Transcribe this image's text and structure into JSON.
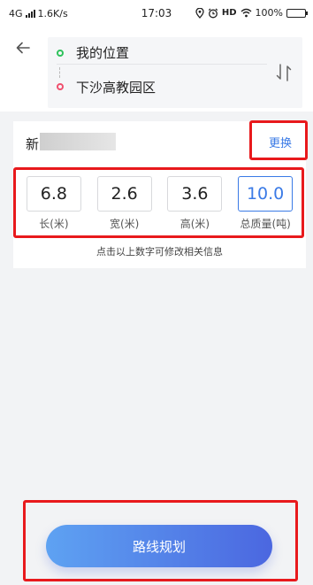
{
  "status_bar": {
    "network": "4G",
    "speed": "1.6K/s",
    "time": "17:03",
    "hd": "HD",
    "battery": "100%"
  },
  "route": {
    "start": "我的位置",
    "end": "下沙高教园区"
  },
  "vehicle": {
    "plate_prefix": "新",
    "change_label": "更换"
  },
  "dimensions": [
    {
      "value": "6.8",
      "label": "长(米)"
    },
    {
      "value": "2.6",
      "label": "宽(米)"
    },
    {
      "value": "3.6",
      "label": "高(米)"
    },
    {
      "value": "10.0",
      "label": "总质量(吨)"
    }
  ],
  "hint": "点击以上数字可修改相关信息",
  "plan_button": "路线规划",
  "colors": {
    "accent": "#3a7ae6",
    "button_gradient_start": "#5ea2f2",
    "button_gradient_end": "#4b67e0",
    "annotation": "#e8191c"
  }
}
